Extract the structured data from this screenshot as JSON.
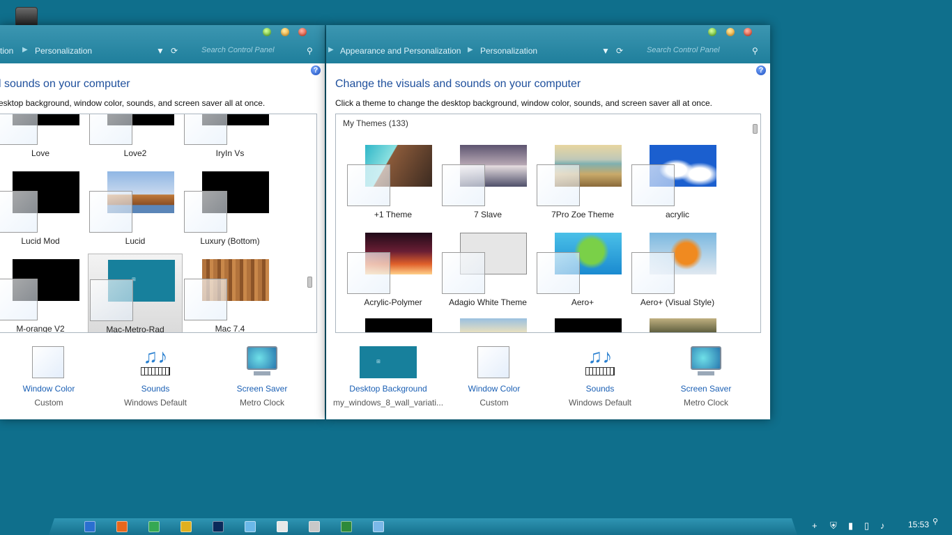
{
  "taskbar": {
    "clock": "15:53",
    "apps": [
      {
        "icon": "document-icon",
        "color": "#2a6fd0"
      },
      {
        "icon": "firefox-icon",
        "color": "#e8671c"
      },
      {
        "icon": "chrome-icon",
        "color": "#35a853"
      },
      {
        "icon": "chrome-icon",
        "color": "#e0b020"
      },
      {
        "icon": "photoshop-icon",
        "color": "#0a2a5a"
      },
      {
        "icon": "monitor-icon",
        "color": "#6ab8e8"
      },
      {
        "icon": "mail-icon",
        "color": "#e8e8e8"
      },
      {
        "icon": "recycle-bin-icon",
        "color": "#c8c8c8"
      },
      {
        "icon": "task-manager-icon",
        "color": "#2e8a3a"
      },
      {
        "icon": "control-panel-icon",
        "color": "#7ab8e8"
      }
    ],
    "tray": [
      "plus-icon",
      "network-shield-icon",
      "signal-icon",
      "power-icon",
      "volume-icon",
      "search-icon"
    ]
  },
  "left_window": {
    "breadcrumb": [
      "tion",
      "Personalization"
    ],
    "search_placeholder": "Search Control Panel",
    "heading": "l sounds on your computer",
    "description": "esktop background, window color, sounds, and screen saver all at once.",
    "themes": [
      {
        "name": "Love",
        "preview": "#000000"
      },
      {
        "name": "Love2",
        "preview": "#000000"
      },
      {
        "name": "IryIn Vs",
        "preview": "#000000"
      },
      {
        "name": "Lucid Mod",
        "preview": "#000000"
      },
      {
        "name": "Lucid",
        "preview": "rock"
      },
      {
        "name": "Luxury (Bottom)",
        "preview": "#000000"
      },
      {
        "name": "M-orange V2",
        "preview": "#000000"
      },
      {
        "name": "Mac-Metro-Rad",
        "preview": "win8",
        "selected": true
      },
      {
        "name": "Mac 7.4",
        "preview": "wood"
      }
    ],
    "bottom": [
      {
        "label": "Window Color",
        "sub": "Custom",
        "icon": "window-color-icon"
      },
      {
        "label": "Sounds",
        "sub": "Windows Default",
        "icon": "sounds-icon"
      },
      {
        "label": "Screen Saver",
        "sub": "Metro Clock",
        "icon": "screen-saver-icon"
      }
    ]
  },
  "right_window": {
    "breadcrumb": [
      "Appearance and Personalization",
      "Personalization"
    ],
    "search_placeholder": "Search Control Panel",
    "heading": "Change the visuals and sounds on your computer",
    "description": "Click a theme to change the desktop background, window color, sounds, and screen saver all at once.",
    "group_label": "My Themes (133)",
    "themes": [
      {
        "name": "+1 Theme",
        "preview": "building"
      },
      {
        "name": "7 Slave",
        "preview": "lake"
      },
      {
        "name": "7Pro Zoe Theme",
        "preview": "beach"
      },
      {
        "name": "acrylic",
        "preview": "clouds"
      },
      {
        "name": "Acrylic-Polymer",
        "preview": "sunset"
      },
      {
        "name": "Adagio White Theme",
        "preview": "white"
      },
      {
        "name": "Aero+",
        "preview": "leaf"
      },
      {
        "name": "Aero+ (Visual Style)",
        "preview": "autumn"
      }
    ],
    "bottom": [
      {
        "label": "Desktop Background",
        "sub": "my_windows_8_wall_variati...",
        "icon": "desktop-background-icon"
      },
      {
        "label": "Window Color",
        "sub": "Custom",
        "icon": "window-color-icon"
      },
      {
        "label": "Sounds",
        "sub": "Windows Default",
        "icon": "sounds-icon"
      },
      {
        "label": "Screen Saver",
        "sub": "Metro Clock",
        "icon": "screen-saver-icon"
      }
    ]
  },
  "colors": {
    "desktop": "#0f6f8c",
    "chrome": "#2a88a6",
    "link": "#1a5fb4",
    "heading": "#1e4f9c"
  }
}
